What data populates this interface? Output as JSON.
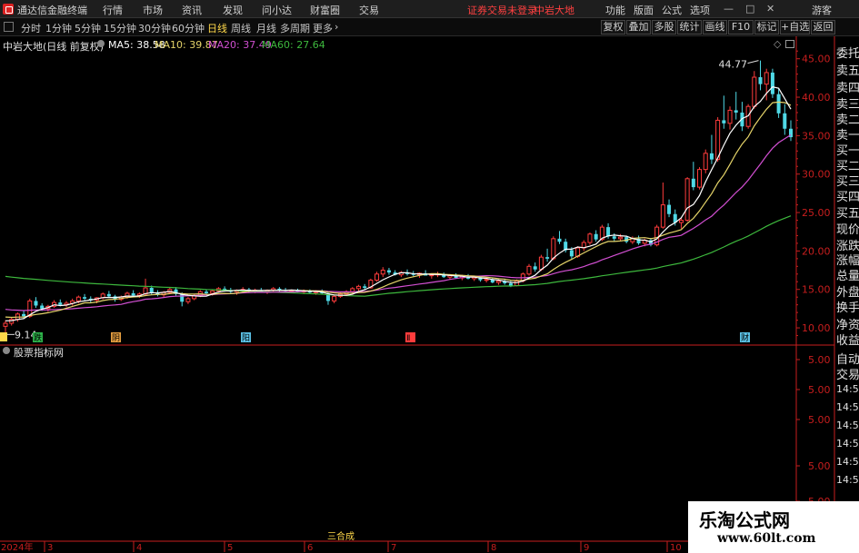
{
  "menubar": {
    "app_title": "通达信金融终端",
    "menus": [
      "行情",
      "市场",
      "资讯",
      "发现",
      "问小达",
      "财富圈",
      "交易"
    ],
    "status_warning": "证券交易未登录",
    "stock_name": "中岩大地",
    "right_items": [
      "功能",
      "版面",
      "公式",
      "选项"
    ],
    "user": "游客"
  },
  "toolbar": {
    "periods": [
      "分时",
      "1分钟",
      "5分钟",
      "15分钟",
      "30分钟",
      "60分钟",
      "日线",
      "周线",
      "月线",
      "多周期",
      "更多"
    ],
    "active_period": "日线",
    "more_arrow": "›",
    "buttons": [
      "复权",
      "叠加",
      "多股",
      "统计",
      "画线",
      "F10",
      "标记",
      "+自选",
      "返回"
    ]
  },
  "chart_header": {
    "title": "中岩大地(日线 前复权)",
    "ma5": "MA5: 38.58",
    "ma10": "MA10: 39.87",
    "ma20": "MA20: 37.49",
    "ma60": "MA60: 27.64",
    "sub_title": "股票指标网"
  },
  "colors": {
    "ma5": "#ffffff",
    "ma10": "#e6d56a",
    "ma20": "#d24fd2",
    "ma60": "#3db83d",
    "up": "#ff3c3c",
    "down": "#4fd9e6",
    "axis": "#c81e1e",
    "label_yellow": "#ffd84a"
  },
  "icons": {
    "logo": "app-logo-icon",
    "settings_dot": "settings-dot-icon",
    "diamond": "diamond-icon",
    "window": "window-restore-icon"
  },
  "right_panel": {
    "labels": [
      "委托",
      "卖五",
      "卖四",
      "卖三",
      "卖二",
      "卖一",
      "买一",
      "买二",
      "买三",
      "买四",
      "买五",
      "现价",
      "涨跌",
      "涨幅",
      "总量",
      "外盘",
      "换手",
      "净资",
      "收益"
    ],
    "bottom_labels": [
      "自动",
      "交易"
    ],
    "sub_ticks": [
      "14:50",
      "14:50",
      "14:50",
      "14:50",
      "14:50",
      "14:50"
    ]
  },
  "event_markers": [
    "跌",
    "阴",
    "阳",
    "Ⅱ",
    "财"
  ],
  "annotations": {
    "max_label": "44.77",
    "min_label": "9.14"
  },
  "bottom_axis": {
    "year_label": "2024年",
    "months": [
      "3",
      "4",
      "5",
      "6",
      "7",
      "8",
      "9",
      "10"
    ],
    "pattern_label": "三合成"
  },
  "watermark": {
    "line1": "乐淘公式网",
    "line2": "www.60lt.com"
  },
  "chart_data": [
    {
      "type": "candlestick",
      "title": "中岩大地(日线 前复权)",
      "ylim": [
        8.0,
        46.5
      ],
      "y_ticks": [
        "45.00",
        "40.00",
        "35.00",
        "30.00",
        "25.00",
        "20.00",
        "15.00",
        "10.00"
      ],
      "x_months": [
        "3",
        "4",
        "5",
        "6",
        "7",
        "8",
        "9",
        "10"
      ],
      "ohlc": [
        [
          10.2,
          11.0,
          9.14,
          10.6
        ],
        [
          10.6,
          11.4,
          10.3,
          11.1
        ],
        [
          11.1,
          12.0,
          10.8,
          11.8
        ],
        [
          11.8,
          12.3,
          11.2,
          11.5
        ],
        [
          11.5,
          13.8,
          11.3,
          13.5
        ],
        [
          13.5,
          14.0,
          12.6,
          12.9
        ],
        [
          12.9,
          13.2,
          12.2,
          12.5
        ],
        [
          12.5,
          13.0,
          12.1,
          12.8
        ],
        [
          12.8,
          13.6,
          12.6,
          13.3
        ],
        [
          13.3,
          13.7,
          12.8,
          13.0
        ],
        [
          13.0,
          13.5,
          12.7,
          13.2
        ],
        [
          13.2,
          13.8,
          12.9,
          13.5
        ],
        [
          13.5,
          14.2,
          13.2,
          14.0
        ],
        [
          14.0,
          14.4,
          13.6,
          13.8
        ],
        [
          13.8,
          14.1,
          13.3,
          13.6
        ],
        [
          13.6,
          14.0,
          13.2,
          13.9
        ],
        [
          13.9,
          14.6,
          13.7,
          14.4
        ],
        [
          14.4,
          14.8,
          13.9,
          14.1
        ],
        [
          14.1,
          14.3,
          13.4,
          13.7
        ],
        [
          13.7,
          14.2,
          13.5,
          14.0
        ],
        [
          14.0,
          14.7,
          13.8,
          14.5
        ],
        [
          14.5,
          14.9,
          14.0,
          14.2
        ],
        [
          14.2,
          14.6,
          13.9,
          14.4
        ],
        [
          14.4,
          16.4,
          14.2,
          15.2
        ],
        [
          15.2,
          15.5,
          14.3,
          14.6
        ],
        [
          14.6,
          14.9,
          14.1,
          14.3
        ],
        [
          14.3,
          14.8,
          14.0,
          14.6
        ],
        [
          14.6,
          15.2,
          14.4,
          15.0
        ],
        [
          15.0,
          15.3,
          14.2,
          14.4
        ],
        [
          14.4,
          14.6,
          12.8,
          13.4
        ],
        [
          13.4,
          14.0,
          13.1,
          13.8
        ],
        [
          13.8,
          14.4,
          13.6,
          14.2
        ],
        [
          14.2,
          14.9,
          14.0,
          14.7
        ],
        [
          14.7,
          15.0,
          14.3,
          14.5
        ],
        [
          14.5,
          14.9,
          14.2,
          14.8
        ],
        [
          14.8,
          15.3,
          14.6,
          15.1
        ],
        [
          15.1,
          15.4,
          14.7,
          14.9
        ],
        [
          14.9,
          15.2,
          14.5,
          14.7
        ],
        [
          14.7,
          15.0,
          14.3,
          14.9
        ],
        [
          14.9,
          15.3,
          14.6,
          15.0
        ],
        [
          15.0,
          15.2,
          14.6,
          14.8
        ],
        [
          14.8,
          15.1,
          14.5,
          14.9
        ],
        [
          14.9,
          15.2,
          14.6,
          14.7
        ],
        [
          14.7,
          15.0,
          14.4,
          14.9
        ],
        [
          14.9,
          15.3,
          14.7,
          15.1
        ],
        [
          15.1,
          15.3,
          14.7,
          14.9
        ],
        [
          14.9,
          15.2,
          14.6,
          14.8
        ],
        [
          14.8,
          15.0,
          14.5,
          14.9
        ],
        [
          14.9,
          15.1,
          14.6,
          14.7
        ],
        [
          14.7,
          15.0,
          14.4,
          14.8
        ],
        [
          14.8,
          15.0,
          14.4,
          14.6
        ],
        [
          14.6,
          14.9,
          14.3,
          14.7
        ],
        [
          14.7,
          15.0,
          14.4,
          14.5
        ],
        [
          14.5,
          14.7,
          13.0,
          13.5
        ],
        [
          13.5,
          14.3,
          13.2,
          14.1
        ],
        [
          14.1,
          14.6,
          13.9,
          14.4
        ],
        [
          14.4,
          14.9,
          14.2,
          14.7
        ],
        [
          14.7,
          15.3,
          14.5,
          15.1
        ],
        [
          15.1,
          15.6,
          14.8,
          15.4
        ],
        [
          15.4,
          15.7,
          15.0,
          15.2
        ],
        [
          15.2,
          16.4,
          15.1,
          16.2
        ],
        [
          16.2,
          17.3,
          16.0,
          17.0
        ],
        [
          17.0,
          17.9,
          16.6,
          17.5
        ],
        [
          17.5,
          17.8,
          16.9,
          17.2
        ],
        [
          17.2,
          17.5,
          16.8,
          16.9
        ],
        [
          16.9,
          17.4,
          16.6,
          17.2
        ],
        [
          17.2,
          17.6,
          16.8,
          17.0
        ],
        [
          17.0,
          17.4,
          16.7,
          16.9
        ],
        [
          16.9,
          17.2,
          16.5,
          17.1
        ],
        [
          17.1,
          17.5,
          16.8,
          16.8
        ],
        [
          16.8,
          17.1,
          16.4,
          16.9
        ],
        [
          16.9,
          17.3,
          16.6,
          17.0
        ],
        [
          17.0,
          17.2,
          16.5,
          16.6
        ],
        [
          16.6,
          17.0,
          16.3,
          16.8
        ],
        [
          16.8,
          17.1,
          16.4,
          16.5
        ],
        [
          16.5,
          16.9,
          16.2,
          16.7
        ],
        [
          16.7,
          17.0,
          16.3,
          16.4
        ],
        [
          16.4,
          16.8,
          16.1,
          16.6
        ],
        [
          16.6,
          16.8,
          16.0,
          16.2
        ],
        [
          16.2,
          16.6,
          15.9,
          16.3
        ],
        [
          16.3,
          16.5,
          15.8,
          15.9
        ],
        [
          15.9,
          16.3,
          15.6,
          16.1
        ],
        [
          16.1,
          16.4,
          15.6,
          15.8
        ],
        [
          15.8,
          16.1,
          15.3,
          15.5
        ],
        [
          15.5,
          16.3,
          15.4,
          16.1
        ],
        [
          16.1,
          17.2,
          15.9,
          17.0
        ],
        [
          17.0,
          18.3,
          16.8,
          18.0
        ],
        [
          18.0,
          18.5,
          17.3,
          17.6
        ],
        [
          17.6,
          19.5,
          17.4,
          19.2
        ],
        [
          19.2,
          20.3,
          18.6,
          19.0
        ],
        [
          19.0,
          21.9,
          18.8,
          21.6
        ],
        [
          21.6,
          22.6,
          20.9,
          21.2
        ],
        [
          21.2,
          21.6,
          19.8,
          20.1
        ],
        [
          20.1,
          20.5,
          18.9,
          19.3
        ],
        [
          19.3,
          20.6,
          19.1,
          20.4
        ],
        [
          20.4,
          21.4,
          20.0,
          21.1
        ],
        [
          21.1,
          22.4,
          20.8,
          22.2
        ],
        [
          22.2,
          22.7,
          21.2,
          21.5
        ],
        [
          21.5,
          23.4,
          21.3,
          23.1
        ],
        [
          23.1,
          23.6,
          21.6,
          21.9
        ],
        [
          21.9,
          22.3,
          21.2,
          21.6
        ],
        [
          21.6,
          22.2,
          21.3,
          21.8
        ],
        [
          21.8,
          22.0,
          21.0,
          21.2
        ],
        [
          21.2,
          21.9,
          20.9,
          21.6
        ],
        [
          21.6,
          22.0,
          20.8,
          21.0
        ],
        [
          21.0,
          21.6,
          20.6,
          21.4
        ],
        [
          21.4,
          21.7,
          20.6,
          20.8
        ],
        [
          20.8,
          23.4,
          20.6,
          23.1
        ],
        [
          23.1,
          28.9,
          22.9,
          26.0
        ],
        [
          26.0,
          26.7,
          24.4,
          24.8
        ],
        [
          24.8,
          25.4,
          23.3,
          23.7
        ],
        [
          23.7,
          24.3,
          22.9,
          24.0
        ],
        [
          24.0,
          29.6,
          23.8,
          29.4
        ],
        [
          29.4,
          31.6,
          27.9,
          28.3
        ],
        [
          28.3,
          30.9,
          28.0,
          30.6
        ],
        [
          30.6,
          33.2,
          30.1,
          32.7
        ],
        [
          32.7,
          35.1,
          31.3,
          31.9
        ],
        [
          31.9,
          37.4,
          31.6,
          37.0
        ],
        [
          37.0,
          40.2,
          35.9,
          36.6
        ],
        [
          36.6,
          38.8,
          35.8,
          38.3
        ],
        [
          38.3,
          40.7,
          37.1,
          38.0
        ],
        [
          38.0,
          39.4,
          35.6,
          36.2
        ],
        [
          36.2,
          39.1,
          35.9,
          38.8
        ],
        [
          38.8,
          43.4,
          38.5,
          42.6
        ],
        [
          42.6,
          44.77,
          40.9,
          41.7
        ],
        [
          41.7,
          43.7,
          39.6,
          43.2
        ],
        [
          43.2,
          43.7,
          39.9,
          40.4
        ],
        [
          40.4,
          41.2,
          37.3,
          37.9
        ],
        [
          37.9,
          39.1,
          35.1,
          35.9
        ],
        [
          35.9,
          37.0,
          34.3,
          34.8
        ]
      ],
      "ma5_last": 38.58,
      "ma10_last": 39.87,
      "ma20_last": 37.49,
      "ma60_last": 27.64
    },
    {
      "type": "line",
      "title": "股票指标网",
      "y_ticks": [
        "5.00",
        "5.00",
        "5.00",
        "5.00",
        "5.00"
      ],
      "series": []
    }
  ]
}
